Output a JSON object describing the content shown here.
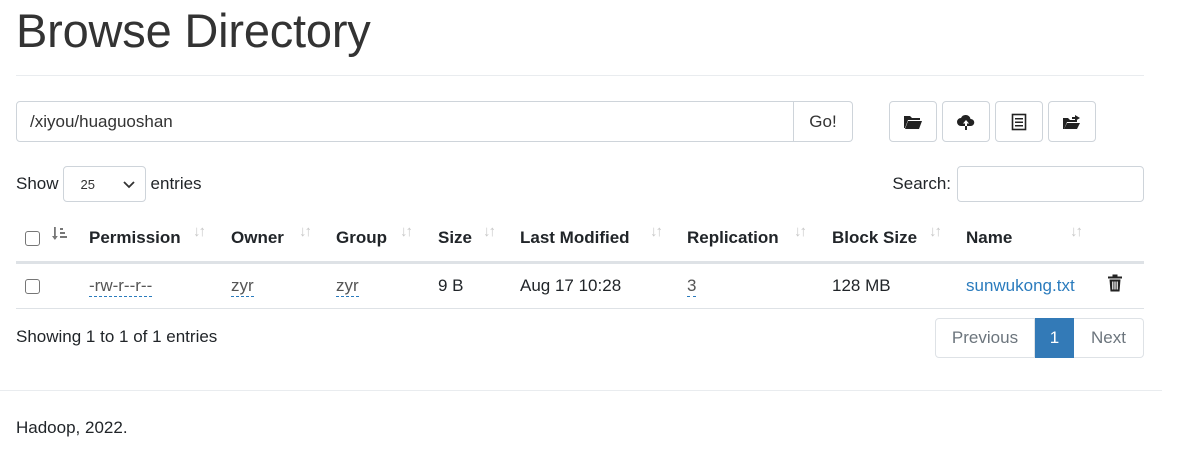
{
  "page": {
    "title": "Browse Directory",
    "footer": "Hadoop, 2022."
  },
  "path_bar": {
    "value": "/xiyou/huaguoshan",
    "go_label": "Go!"
  },
  "toolbar": {
    "buttons": [
      {
        "icon": "folder-open-icon"
      },
      {
        "icon": "cloud-upload-icon"
      },
      {
        "icon": "list-document-icon"
      },
      {
        "icon": "folder-move-icon"
      }
    ]
  },
  "length_menu": {
    "prefix": "Show",
    "selected": "25",
    "suffix": "entries"
  },
  "search": {
    "label": "Search:",
    "value": ""
  },
  "table": {
    "columns": [
      "Permission",
      "Owner",
      "Group",
      "Size",
      "Last Modified",
      "Replication",
      "Block Size",
      "Name"
    ],
    "rows": [
      {
        "permission": "-rw-r--r--",
        "owner": "zyr",
        "group": "zyr",
        "size": "9 B",
        "last_modified": "Aug 17 10:28",
        "replication": "3",
        "block_size": "128 MB",
        "name": "sunwukong.txt"
      }
    ]
  },
  "info": "Showing 1 to 1 of 1 entries",
  "pagination": {
    "previous": "Previous",
    "current": "1",
    "next": "Next"
  },
  "colors": {
    "accent": "#337ab7",
    "link": "#2a7bbd",
    "text": "#212529",
    "border": "#dee2e6"
  }
}
